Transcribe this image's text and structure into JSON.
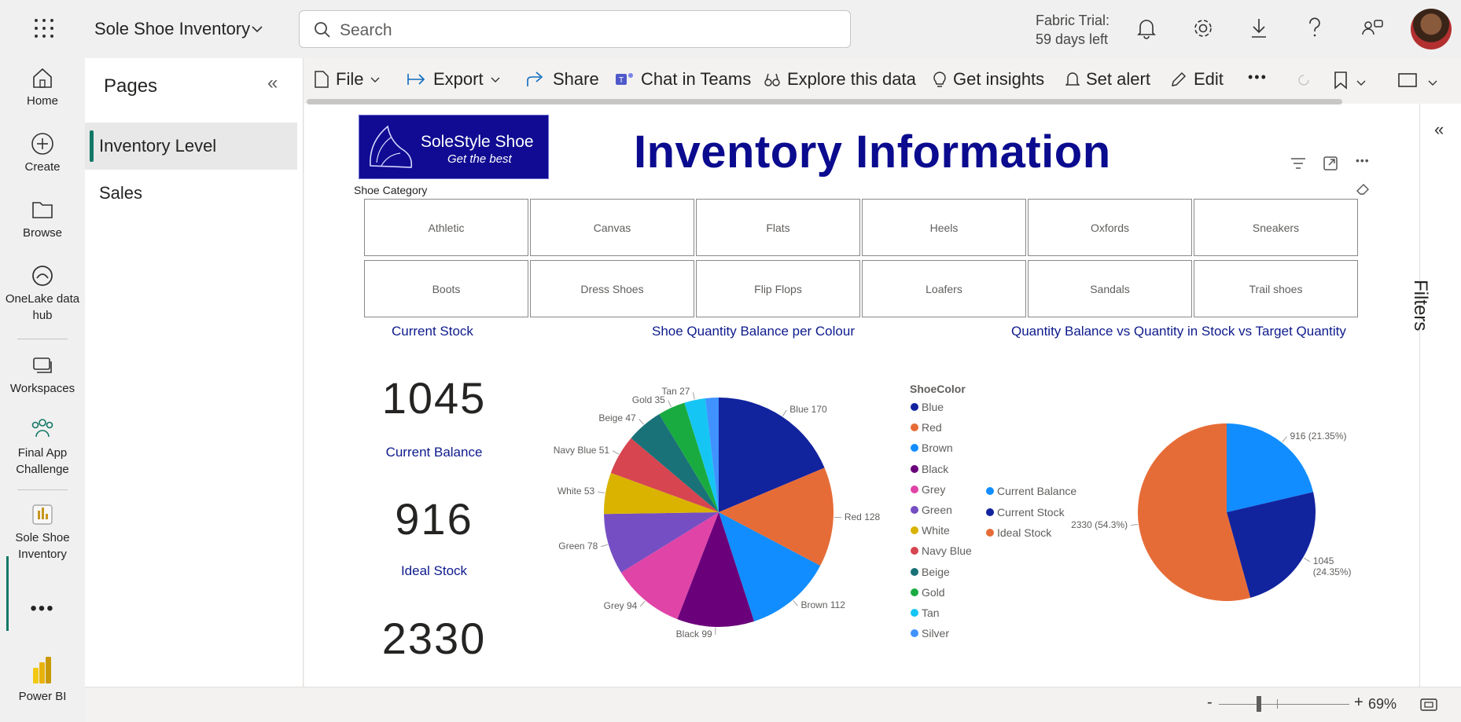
{
  "app": {
    "title": "Sole Shoe Inventory",
    "search_placeholder": "Search",
    "trial_line1": "Fabric Trial:",
    "trial_line2": "59 days left"
  },
  "nav": [
    {
      "label": "Home",
      "icon": "home-icon"
    },
    {
      "label": "Create",
      "icon": "plus-circle-icon"
    },
    {
      "label": "Browse",
      "icon": "folder-icon"
    },
    {
      "label": "OneLake data hub",
      "icon": "onelake-icon"
    },
    {
      "label": "Workspaces",
      "icon": "workspaces-icon"
    },
    {
      "label": "Final App Challenge",
      "icon": "people-icon"
    },
    {
      "label": "Sole Shoe Inventory",
      "icon": "report-icon"
    },
    {
      "label": "Power BI",
      "icon": "powerbi-logo-icon"
    }
  ],
  "pages": {
    "title": "Pages",
    "items": [
      "Inventory Level",
      "Sales"
    ]
  },
  "toolbar": {
    "file": "File",
    "export": "Export",
    "share": "Share",
    "chat": "Chat in Teams",
    "explore": "Explore this data",
    "insights": "Get insights",
    "alert": "Set alert",
    "edit": "Edit"
  },
  "filters_label": "Filters",
  "report": {
    "logo_text1": "SoleStyle Shoe",
    "logo_text2": "Get the best",
    "title": "Inventory Information",
    "slicer_title": "Shoe Category",
    "categories": [
      "Athletic",
      "Canvas",
      "Flats",
      "Heels",
      "Oxfords",
      "Sneakers",
      "Boots",
      "Dress Shoes",
      "Flip Flops",
      "Loafers",
      "Sandals",
      "Trail shoes"
    ],
    "kpi": {
      "title": "Current Stock",
      "current_stock": "1045",
      "balance_label": "Current Balance",
      "current_balance": "916",
      "ideal_label": "Ideal Stock",
      "ideal_stock": "2330"
    }
  },
  "status": {
    "zoom": "69%"
  },
  "chart_data": [
    {
      "type": "pie",
      "title": "Shoe Quantity Balance per Colour",
      "legend_title": "ShoeColor",
      "legend": "right",
      "categories": [
        "Blue",
        "Red",
        "Brown",
        "Black",
        "Grey",
        "Green",
        "White",
        "Navy Blue",
        "Beige",
        "Gold",
        "Tan",
        "Silver"
      ],
      "values": [
        170,
        128,
        112,
        99,
        94,
        78,
        53,
        51,
        47,
        35,
        27,
        17
      ],
      "colors": [
        "#12239e",
        "#e66c37",
        "#118dff",
        "#6b007b",
        "#e044a7",
        "#744ec2",
        "#d9b300",
        "#d64550",
        "#197278",
        "#1aab40",
        "#15c6f4",
        "#4092ff"
      ],
      "data_labels": [
        "Blue 170",
        "Red 128",
        "Brown 112",
        "Black 99",
        "Grey 94",
        "Green 78",
        "White 53",
        "Navy Blue 51",
        "Beige 47",
        "Gold 35",
        "Tan 27",
        ""
      ]
    },
    {
      "type": "pie",
      "title": "Quantity Balance vs Quantity in Stock vs Target Quantity",
      "legend": "left",
      "categories": [
        "Current Balance",
        "Current Stock",
        "Ideal Stock"
      ],
      "values": [
        916,
        1045,
        2330
      ],
      "colors": [
        "#118dff",
        "#12239e",
        "#e66c37"
      ],
      "data_labels": [
        "916 (21.35%)",
        "1045 (24.35%)",
        "2330 (54.3%)"
      ]
    }
  ]
}
